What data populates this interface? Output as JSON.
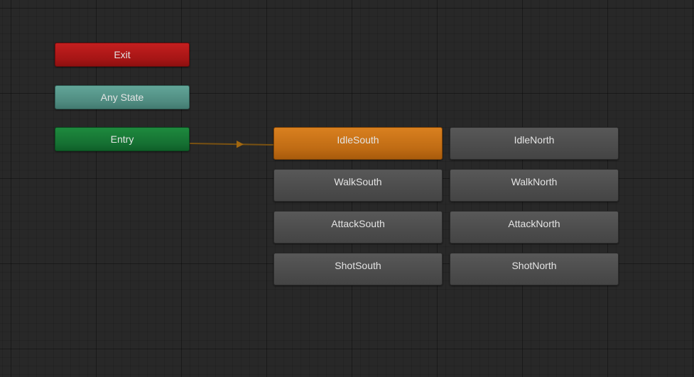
{
  "graph": {
    "special_states": {
      "exit": "Exit",
      "any_state": "Any State",
      "entry": "Entry"
    },
    "states": [
      {
        "label": "IdleSouth",
        "is_default": true
      },
      {
        "label": "IdleNorth",
        "is_default": false
      },
      {
        "label": "WalkSouth",
        "is_default": false
      },
      {
        "label": "WalkNorth",
        "is_default": false
      },
      {
        "label": "AttackSouth",
        "is_default": false
      },
      {
        "label": "AttackNorth",
        "is_default": false
      },
      {
        "label": "ShotSouth",
        "is_default": false
      },
      {
        "label": "ShotNorth",
        "is_default": false
      }
    ],
    "transitions": [
      {
        "from": "Entry",
        "to": "IdleSouth"
      }
    ]
  },
  "colors": {
    "background": "#282828",
    "exit": "#b31a1a",
    "any_state": "#589a8e",
    "entry": "#187b37",
    "default_state": "#cc7519",
    "state": "#505050",
    "default_transition": "#a3680f"
  }
}
